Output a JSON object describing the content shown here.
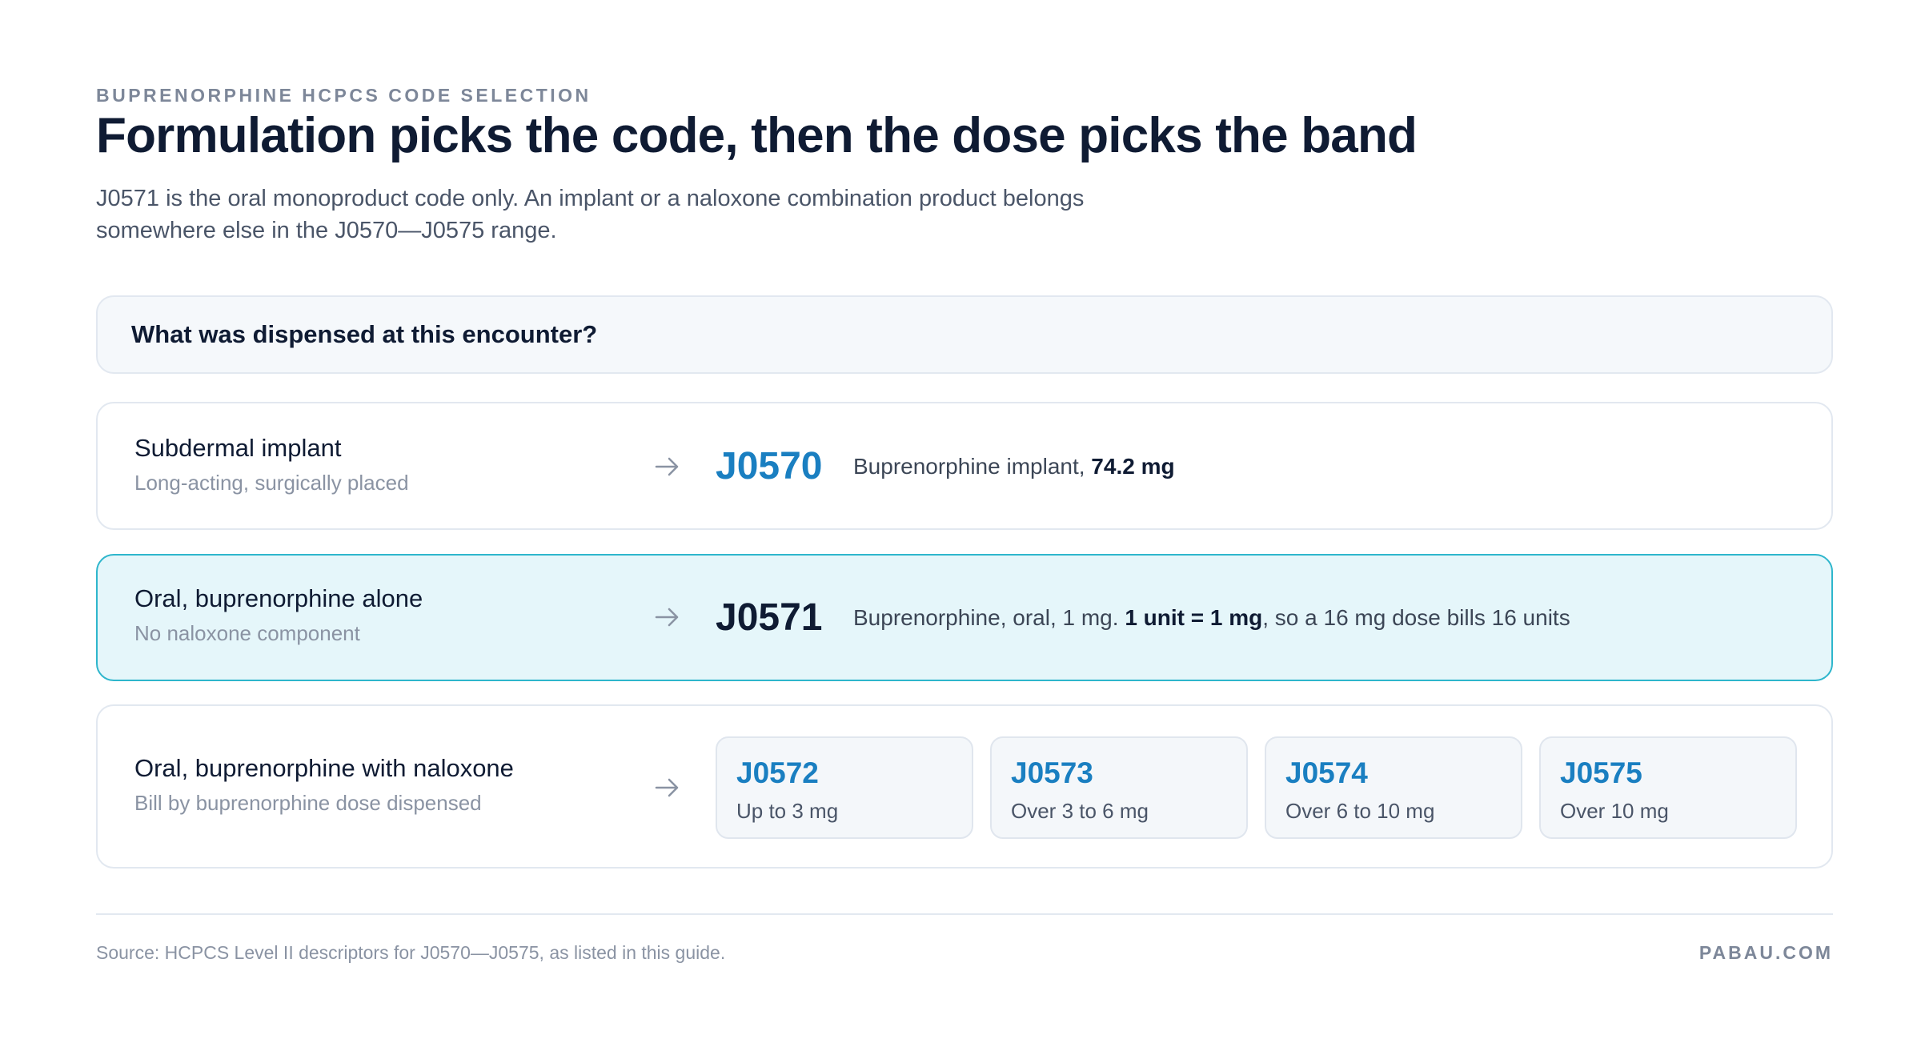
{
  "header": {
    "eyebrow": "BUPRENORPHINE HCPCS CODE SELECTION",
    "title": "Formulation picks the code, then the dose picks the band",
    "subtitle_line1": "J0571 is the oral monoproduct code only. An implant or a naloxone combination product belongs",
    "subtitle_line2": "somewhere else in the J0570—J0575 range."
  },
  "question": "What was dispensed at this encounter?",
  "rows": {
    "implant": {
      "title": "Subdermal implant",
      "subtitle": "Long-acting, surgically placed",
      "code": "J0570",
      "desc_prefix": "Buprenorphine implant, ",
      "desc_bold": "74.2 mg"
    },
    "oral_alone": {
      "title": "Oral, buprenorphine alone",
      "subtitle": "No naloxone component",
      "code": "J0571",
      "desc_prefix": "Buprenorphine, oral, 1 mg. ",
      "desc_bold": "1 unit = 1 mg",
      "desc_suffix": ", so a 16 mg dose bills 16 units"
    },
    "oral_naloxone": {
      "title": "Oral, buprenorphine with naloxone",
      "subtitle": "Bill by buprenorphine dose dispensed",
      "bands": [
        {
          "code": "J0572",
          "range": "Up to 3 mg"
        },
        {
          "code": "J0573",
          "range": "Over 3 to 6 mg"
        },
        {
          "code": "J0574",
          "range": "Over 6 to 10 mg"
        },
        {
          "code": "J0575",
          "range": "Over 10 mg"
        }
      ]
    }
  },
  "footer": {
    "source": "Source: HCPCS Level II descriptors for J0570—J0575, as listed in this guide.",
    "brand": "PABAU.COM"
  },
  "colors": {
    "accent": "#1a7fc1",
    "highlight_bg": "#e5f6fa",
    "highlight_border": "#2eb6cc"
  },
  "icons": {
    "row_arrow": "arrow-right-icon"
  }
}
